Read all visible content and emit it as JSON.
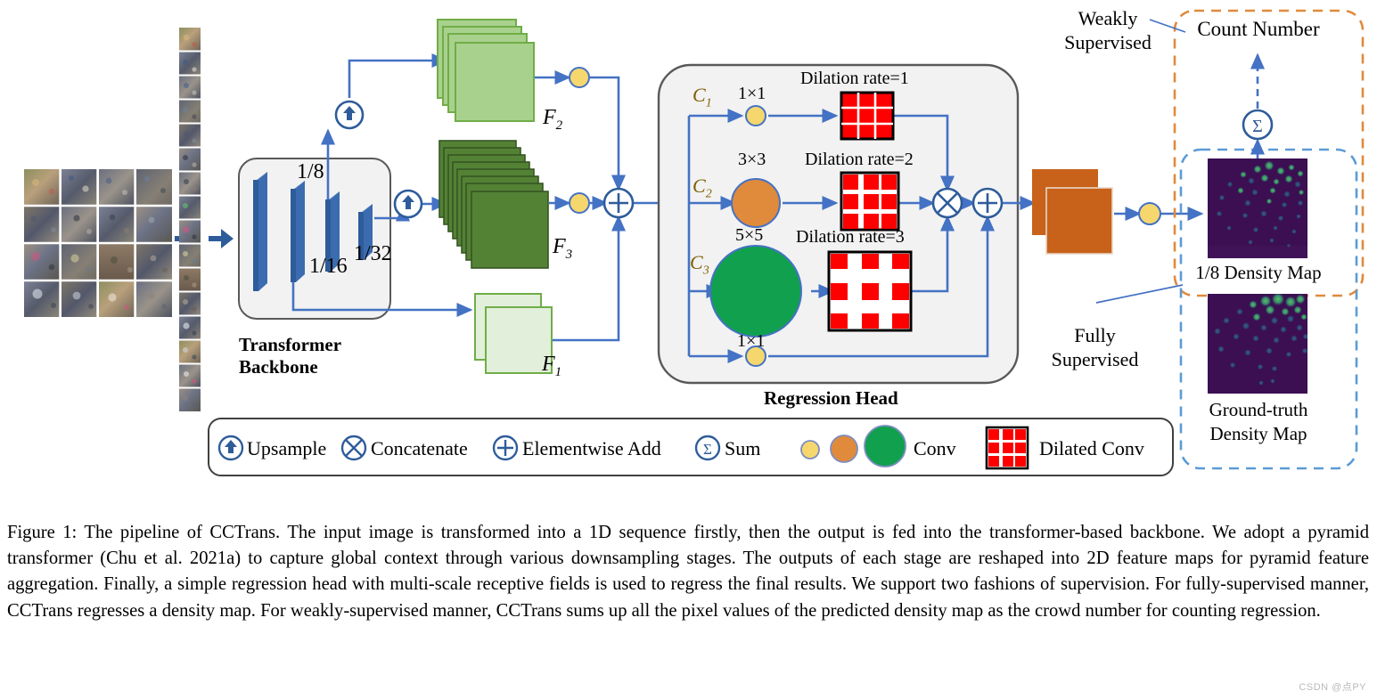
{
  "figure": {
    "id": "Figure 1",
    "caption": "Figure 1: The pipeline of CCTrans. The input image is transformed into a 1D sequence firstly, then the output is fed into the transformer-based backbone. We adopt a pyramid transformer (Chu et al. 2021a) to capture global context through various downsampling stages. The outputs of each stage are reshaped into 2D feature maps for pyramid feature aggregation. Finally, a simple regression head with multi-scale receptive fields is used to regress the final results. We support two fashions of supervision. For fully-supervised manner, CCTrans regresses a density map. For weakly-supervised manner, CCTrans sums up all the pixel values of the predicted density map as the crowd number for counting regression.",
    "watermark": "CSDN @点PY"
  },
  "backbone": {
    "title_line1": "Transformer",
    "title_line2": "Backbone",
    "stage_labels": [
      "1/8",
      "1/16",
      "1/32"
    ]
  },
  "features": {
    "f2": "F2",
    "f3": "F3",
    "f1": "F1",
    "f2_sub": "2",
    "f3_sub": "3",
    "f1_sub": "1",
    "f_base": "F"
  },
  "regression_head": {
    "title": "Regression Head",
    "branches": [
      {
        "channel": "C",
        "channel_sub": "1",
        "kernel": "1×1",
        "dilation": "Dilation rate=1"
      },
      {
        "channel": "C",
        "channel_sub": "2",
        "kernel": "3×3",
        "dilation": "Dilation rate=2"
      },
      {
        "channel": "C",
        "channel_sub": "3",
        "kernel": "5×5",
        "dilation": "Dilation rate=3"
      }
    ],
    "bottom_kernel": "1×1"
  },
  "supervision": {
    "weakly_line1": "Weakly",
    "weakly_line2": "Supervised",
    "fully_line1": "Fully",
    "fully_line2": "Supervised",
    "count_number": "Count Number",
    "sum_symbol": "Σ",
    "density_map_label": "1/8 Density Map",
    "gt_line1": "Ground-truth",
    "gt_line2": "Density Map",
    "weakly_border_color": "#E08A3C",
    "fully_border_color": "#5B9BD5"
  },
  "legend": {
    "items": [
      {
        "icon": "upsample-icon",
        "label": "Upsample"
      },
      {
        "icon": "concatenate-icon",
        "label": "Concatenate"
      },
      {
        "icon": "elementwise-add-icon",
        "label": "Elementwise Add"
      },
      {
        "icon": "sum-icon",
        "label": "Sum"
      },
      {
        "icon": "conv-circles-icon",
        "label": "Conv"
      },
      {
        "icon": "dilated-conv-icon",
        "label": "Dilated Conv"
      }
    ]
  },
  "colors": {
    "arrow_blue": "#4472C4",
    "backbone_blue": "#2E5C9A",
    "f1_green": "#DDEFD0",
    "f2_green": "#A9D18E",
    "f3_green": "#548235",
    "orange_block": "#C8621A",
    "conv_yellow": "#F5D76E",
    "conv_orange": "#E08A3C",
    "conv_green": "#11A04D",
    "dilated_red": "#FE0000",
    "panel_gray": "#F2F2F2",
    "density_bg": "#3B0F52"
  }
}
